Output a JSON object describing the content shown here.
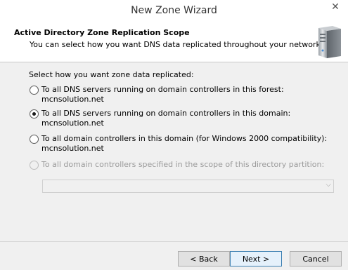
{
  "window": {
    "title": "New Zone Wizard",
    "close_glyph": "✕"
  },
  "header": {
    "title": "Active Directory Zone Replication Scope",
    "subtitle": "You can select how you want DNS data replicated throughout your network.",
    "icon": "server-icon"
  },
  "content": {
    "prompt": "Select how you want zone data replicated:",
    "options": [
      {
        "label": "To all DNS servers running on domain controllers in this forest: mcnsolution.net",
        "selected": false,
        "enabled": true
      },
      {
        "label": "To all DNS servers running on domain controllers in this domain: mcnsolution.net",
        "selected": true,
        "enabled": true
      },
      {
        "label": "To all domain controllers in this domain (for Windows 2000 compatibility):",
        "label_line2": "mcnsolution.net",
        "selected": false,
        "enabled": true
      },
      {
        "label": "To all domain controllers specified in the scope of this directory partition:",
        "selected": false,
        "enabled": false
      }
    ],
    "partition_combo": {
      "value": "",
      "enabled": false
    }
  },
  "footer": {
    "back_label": "< Back",
    "next_label": "Next >",
    "cancel_label": "Cancel"
  }
}
